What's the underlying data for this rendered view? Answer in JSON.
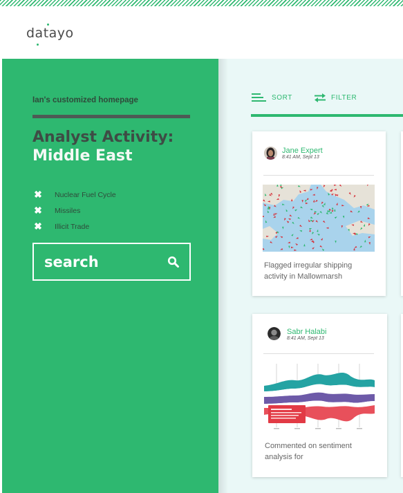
{
  "brand": {
    "logo_text": "datayo",
    "accent": "#2eb870"
  },
  "sidebar": {
    "homepage_label": "Ian's customized homepage",
    "title_line1": "Analyst Activity:",
    "title_line2": "Middle East",
    "tags": [
      {
        "label": "Nuclear Fuel Cycle",
        "icon": "close-icon"
      },
      {
        "label": "Missiles",
        "icon": "close-icon"
      },
      {
        "label": "Illicit Trade",
        "icon": "close-icon"
      }
    ],
    "search": {
      "value": "search",
      "icon": "search-icon"
    }
  },
  "toolbar": {
    "sort_label": "SORT",
    "filter_label": "FILTER"
  },
  "feed": [
    {
      "author": "Jane  Expert",
      "timestamp": "8:41 AM, Sept 13",
      "image": "shipping-map",
      "description": "Flagged irregular shipping activity in Mallowmarsh"
    },
    {
      "author": "Sabr Halabi",
      "timestamp": "8:41 AM, Sept 13",
      "image": "sentiment-streamgraph",
      "description": "Commented on sentiment analysis for"
    }
  ]
}
